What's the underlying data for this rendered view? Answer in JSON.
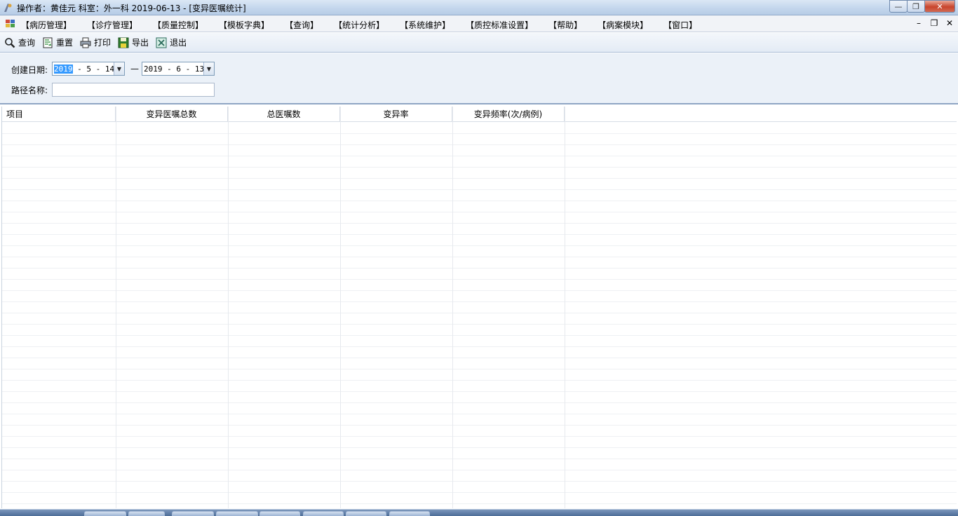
{
  "window": {
    "title": "操作者：黄佳元  科室：外一科  2019-06-13 - [变异医嘱统计]",
    "minimize_label": "—",
    "restore_label": "❐",
    "close_label": "✕"
  },
  "menu": {
    "items": [
      "【病历管理】",
      "【诊疗管理】",
      "【质量控制】",
      "【模板字典】",
      "【查询】",
      "【统计分析】",
      "【系统维护】",
      "【质控标准设置】",
      "【帮助】",
      "【病案模块】",
      "【窗口】"
    ],
    "mdi_minimize": "–",
    "mdi_restore": "❐",
    "mdi_close": "✕"
  },
  "toolbar": {
    "query": "查询",
    "reset": "重置",
    "print": "打印",
    "export": "导出",
    "exit": "退出"
  },
  "filter": {
    "created_date_label": "创建日期:",
    "start_date_year": "2019",
    "start_date_rest": " - 5 - 14",
    "separator": "—",
    "end_date": "2019 - 6 - 13",
    "path_name_label": "路径名称:",
    "path_name_value": ""
  },
  "grid": {
    "columns": [
      "项目",
      "变异医嘱总数",
      "总医嘱数",
      "变异率",
      "变异频率(次/病例)"
    ],
    "rows": []
  },
  "colors": {
    "titlebar": "#c2d5ec",
    "selection": "#3399ff",
    "panel": "#ebf1f8"
  },
  "icons": {
    "query": "magnifier-icon",
    "reset": "reset-document-icon",
    "print": "printer-icon",
    "export": "floppy-disk-icon",
    "exit": "exit-icon"
  }
}
